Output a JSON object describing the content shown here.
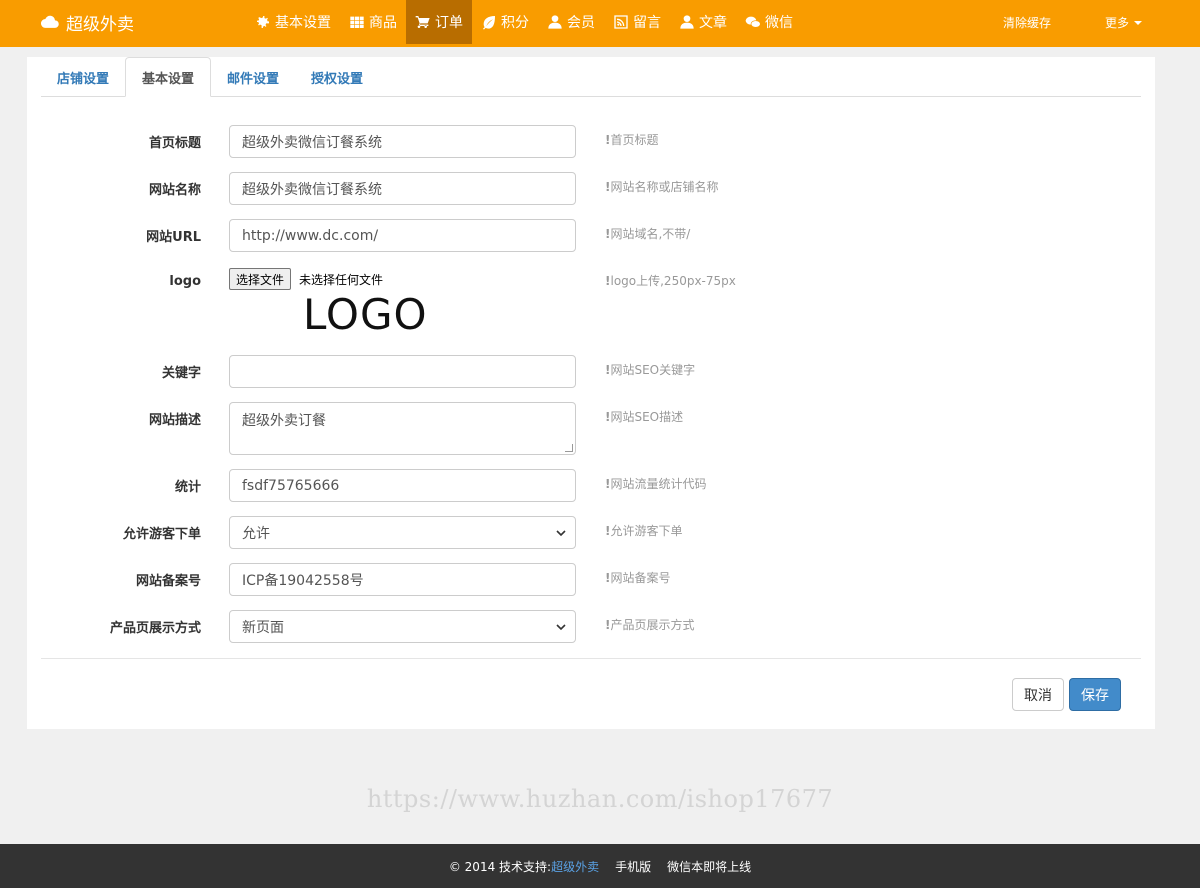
{
  "brand": {
    "name": "超级外卖"
  },
  "nav": {
    "items": [
      {
        "label": "基本设置",
        "icon": "gear-icon"
      },
      {
        "label": "商品",
        "icon": "grid-icon"
      },
      {
        "label": "订单",
        "icon": "cart-icon"
      },
      {
        "label": "积分",
        "icon": "leaf-icon"
      },
      {
        "label": "会员",
        "icon": "user-icon"
      },
      {
        "label": "留言",
        "icon": "rss-icon"
      },
      {
        "label": "文章",
        "icon": "user-icon"
      },
      {
        "label": "微信",
        "icon": "chat-icon"
      }
    ],
    "active_index": 2,
    "clear_cache": "清除缓存",
    "more": "更多"
  },
  "tabs": [
    {
      "label": "店铺设置"
    },
    {
      "label": "基本设置"
    },
    {
      "label": "邮件设置"
    },
    {
      "label": "授权设置"
    }
  ],
  "active_tab": 1,
  "form": {
    "home_title": {
      "label": "首页标题",
      "value": "超级外卖微信订餐系统",
      "help": "首页标题"
    },
    "site_name": {
      "label": "网站名称",
      "value": "超级外卖微信订餐系统",
      "help": "网站名称或店铺名称"
    },
    "site_url": {
      "label": "网站URL",
      "value": "http://www.dc.com/",
      "help": "网站域名,不带/"
    },
    "logo": {
      "label": "logo",
      "button": "选择文件",
      "status": "未选择任何文件",
      "preview_text": "LOGO",
      "help": "logo上传,250px-75px"
    },
    "keywords": {
      "label": "关键字",
      "value": "",
      "help": "网站SEO关键字"
    },
    "description": {
      "label": "网站描述",
      "value": "超级外卖订餐",
      "help": "网站SEO描述"
    },
    "stats": {
      "label": "统计",
      "value": "fsdf75765666",
      "help": "网站流量统计代码"
    },
    "guest_order": {
      "label": "允许游客下单",
      "value": "允许",
      "help": "允许游客下单"
    },
    "icp": {
      "label": "网站备案号",
      "value": "ICP备19042558号",
      "help": "网站备案号"
    },
    "product_display": {
      "label": "产品页展示方式",
      "value": "新页面",
      "help": "产品页展示方式"
    }
  },
  "buttons": {
    "cancel": "取消",
    "save": "保存"
  },
  "watermark": "https://www.huzhan.com/ishop17677",
  "footer": {
    "copyright": "© 2014 技术支持:",
    "company": "超级外卖",
    "mobile": "手机版",
    "wechat": "微信本即将上线"
  },
  "colors": {
    "navbar": "#f99c00",
    "nav_active": "#b86d00",
    "primary": "#428bca",
    "link": "#337ab7"
  }
}
